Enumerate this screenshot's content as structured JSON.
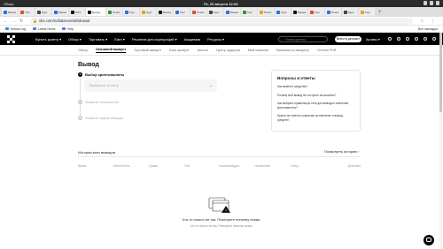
{
  "os": {
    "activities": "Обзор",
    "clock": "Пт, 26 августа  12:06"
  },
  "tabs": [
    {
      "label": "Биржа",
      "color": "#1e73e8"
    },
    {
      "label": "Торг",
      "color": "#e84a1e"
    },
    {
      "label": "Курс",
      "color": "#444444"
    },
    {
      "label": "Биржа",
      "color": "#1e73e8"
    },
    {
      "label": "OKX",
      "color": "#111111"
    },
    {
      "label": "Вывод",
      "color": "#111111",
      "active": true
    },
    {
      "label": "Поиск",
      "color": "#3c8c3c"
    },
    {
      "label": "Торг",
      "color": "#1e73e8"
    },
    {
      "label": "Курс",
      "color": "#e8a21e"
    },
    {
      "label": "Биржа",
      "color": "#111111"
    },
    {
      "label": "Торг",
      "color": "#1e73e8"
    },
    {
      "label": "Поиск",
      "color": "#e84a1e"
    },
    {
      "label": "Курс",
      "color": "#444444"
    },
    {
      "label": "Биржа",
      "color": "#1e73e8"
    },
    {
      "label": "Торг",
      "color": "#3c8c3c"
    },
    {
      "label": "Поиск",
      "color": "#e8a21e"
    },
    {
      "label": "Курс",
      "color": "#1e73e8"
    },
    {
      "label": "Биржа",
      "color": "#111111"
    },
    {
      "label": "Торг",
      "color": "#e84a1e"
    },
    {
      "label": "Поиск",
      "color": "#1e73e8"
    },
    {
      "label": "Курс",
      "color": "#444444"
    },
    {
      "label": "Торг",
      "color": "#e8a21e"
    }
  ],
  "toolbar": {
    "url": "okx.com/ru/balance/withdrawal"
  },
  "bookmarks": {
    "items": [
      "Debian.org",
      "Latest News",
      "Help"
    ],
    "other": "Все закладки"
  },
  "header": {
    "menu": [
      "Купить крипту ▾",
      "Обзор ▾",
      "Торговать ▾",
      "Earn ▾",
      "Решения для корпораций ▾",
      "Академия",
      "Ресурсы ▾"
    ],
    "search_placeholder": "Поиск крипты",
    "deposit_label": "Внести депозит",
    "assets_label": "Активы ▾"
  },
  "subnav": {
    "items": [
      "Обзор",
      "Основной аккаунт",
      "Торговый аккаунт",
      "Earn аккаунт",
      "Аналог",
      "Центр ордеров",
      "Мой кошелек",
      "Выписка по аккаунту",
      "Отчеты PnR"
    ],
    "active_index": 1
  },
  "main": {
    "title": "Вывод",
    "steps": [
      {
        "num": "1",
        "label": "Выбор криптовалюты"
      },
      {
        "num": "2",
        "label": "Укажите назначение"
      },
      {
        "num": "3",
        "label": "Укажите сумму вывода"
      }
    ],
    "select_placeholder": "Выберите монету"
  },
  "faq": {
    "title": "Вопросы и ответы",
    "questions": [
      "Как вывести средства?",
      "Почему мой вывод не поступил на кошелек?",
      "Как выбрать правильную сеть для вывода и внесения криптовалюты?",
      "Нужно ли платить комиссию за внесение и вывод средств?"
    ]
  },
  "history": {
    "title": "История всех выводов",
    "view_all": "Посмотреть историю ›",
    "columns": [
      "Время",
      "Монета/Сеть",
      "Сумма",
      "TxID",
      "Кошелек/Адрес",
      "Назначение",
      "Статус",
      "Действия"
    ],
    "empty_title": "Что-то пошло не так. Повторите попытку позже.",
    "empty_sub": "Что-то пошло не так. Повторите попытку позже."
  }
}
